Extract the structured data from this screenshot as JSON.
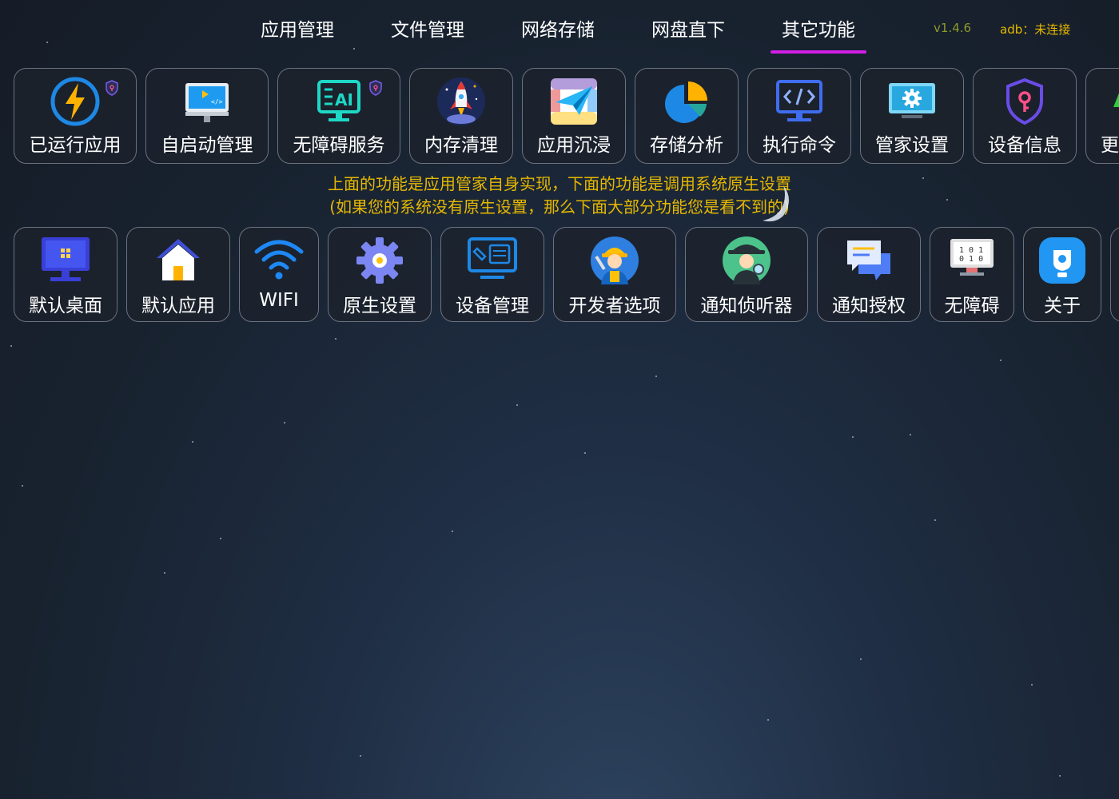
{
  "tabs": [
    {
      "label": "应用管理"
    },
    {
      "label": "文件管理"
    },
    {
      "label": "网络存储"
    },
    {
      "label": "网盘直下"
    },
    {
      "label": "其它功能",
      "active": true
    }
  ],
  "version": "v1.4.6",
  "adb_status": "adb：未连接",
  "top_row": [
    {
      "label": "已运行应用",
      "icon": "lightning-icon"
    },
    {
      "label": "自启动管理",
      "icon": "monitor-code-icon"
    },
    {
      "label": "无障碍服务",
      "icon": "ai-monitor-icon"
    },
    {
      "label": "内存清理",
      "icon": "rocket-icon"
    },
    {
      "label": "应用沉浸",
      "icon": "paper-plane-icon"
    },
    {
      "label": "存储分析",
      "icon": "pie-chart-icon"
    },
    {
      "label": "执行命令",
      "icon": "code-monitor-icon"
    },
    {
      "label": "管家设置",
      "icon": "gear-monitor-icon"
    },
    {
      "label": "设备信息",
      "icon": "shield-key-icon"
    },
    {
      "label": "更",
      "icon": "arrow-icon"
    }
  ],
  "notice": {
    "line1": "上面的功能是应用管家自身实现，下面的功能是调用系统原生设置",
    "line2": "(如果您的系统没有原生设置，那么下面大部分功能您是看不到的)"
  },
  "bottom_row": [
    {
      "label": "默认桌面",
      "icon": "desktop-icon"
    },
    {
      "label": "默认应用",
      "icon": "home-icon"
    },
    {
      "label": "WIFI",
      "icon": "wifi-icon"
    },
    {
      "label": "原生设置",
      "icon": "gear-icon"
    },
    {
      "label": "设备管理",
      "icon": "device-manage-icon"
    },
    {
      "label": "开发者选项",
      "icon": "developer-icon"
    },
    {
      "label": "通知侦听器",
      "icon": "detective-icon"
    },
    {
      "label": "通知授权",
      "icon": "chat-icon"
    },
    {
      "label": "无障碍",
      "icon": "binary-monitor-icon"
    },
    {
      "label": "关于",
      "icon": "about-icon"
    }
  ],
  "colors": {
    "accent_underline": "#d21ee6",
    "notice": "#e6b800",
    "version": "#8c9a2a"
  }
}
